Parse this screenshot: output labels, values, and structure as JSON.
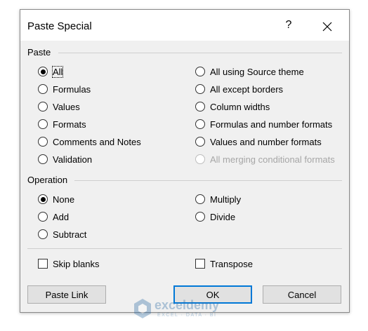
{
  "dialog": {
    "title": "Paste Special",
    "help_label": "?"
  },
  "paste": {
    "label": "Paste",
    "left": [
      {
        "label": "All",
        "checked": true
      },
      {
        "label": "Formulas",
        "checked": false
      },
      {
        "label": "Values",
        "checked": false
      },
      {
        "label": "Formats",
        "checked": false
      },
      {
        "label": "Comments and Notes",
        "checked": false
      },
      {
        "label": "Validation",
        "checked": false
      }
    ],
    "right": [
      {
        "label": "All using Source theme",
        "enabled": true
      },
      {
        "label": "All except borders",
        "enabled": true
      },
      {
        "label": "Column widths",
        "enabled": true
      },
      {
        "label": "Formulas and number formats",
        "enabled": true
      },
      {
        "label": "Values and number formats",
        "enabled": true
      },
      {
        "label": "All merging conditional formats",
        "enabled": false
      }
    ]
  },
  "operation": {
    "label": "Operation",
    "left": [
      {
        "label": "None",
        "checked": true
      },
      {
        "label": "Add",
        "checked": false
      },
      {
        "label": "Subtract",
        "checked": false
      }
    ],
    "right": [
      {
        "label": "Multiply",
        "checked": false
      },
      {
        "label": "Divide",
        "checked": false
      }
    ]
  },
  "options": {
    "skip_blanks": {
      "label": "Skip blanks",
      "checked": false
    },
    "transpose": {
      "label": "Transpose",
      "checked": false
    }
  },
  "buttons": {
    "paste_link": "Paste Link",
    "ok": "OK",
    "cancel": "Cancel"
  },
  "watermark": {
    "name": "exceldemy",
    "tagline": "EXCEL · DATA · BI"
  },
  "colors": {
    "accent": "#0078d7",
    "dialog_bg": "#f0f0f0",
    "disabled_text": "#a6a6a6"
  }
}
